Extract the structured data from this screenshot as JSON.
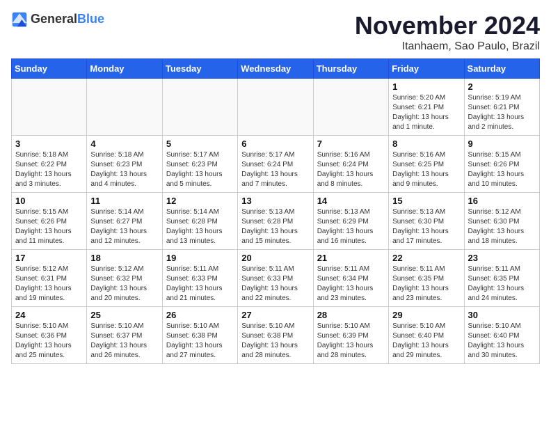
{
  "header": {
    "logo_general": "General",
    "logo_blue": "Blue",
    "month_title": "November 2024",
    "subtitle": "Itanhaem, Sao Paulo, Brazil"
  },
  "weekdays": [
    "Sunday",
    "Monday",
    "Tuesday",
    "Wednesday",
    "Thursday",
    "Friday",
    "Saturday"
  ],
  "weeks": [
    [
      {
        "day": "",
        "info": ""
      },
      {
        "day": "",
        "info": ""
      },
      {
        "day": "",
        "info": ""
      },
      {
        "day": "",
        "info": ""
      },
      {
        "day": "",
        "info": ""
      },
      {
        "day": "1",
        "info": "Sunrise: 5:20 AM\nSunset: 6:21 PM\nDaylight: 13 hours and 1 minute."
      },
      {
        "day": "2",
        "info": "Sunrise: 5:19 AM\nSunset: 6:21 PM\nDaylight: 13 hours and 2 minutes."
      }
    ],
    [
      {
        "day": "3",
        "info": "Sunrise: 5:18 AM\nSunset: 6:22 PM\nDaylight: 13 hours and 3 minutes."
      },
      {
        "day": "4",
        "info": "Sunrise: 5:18 AM\nSunset: 6:23 PM\nDaylight: 13 hours and 4 minutes."
      },
      {
        "day": "5",
        "info": "Sunrise: 5:17 AM\nSunset: 6:23 PM\nDaylight: 13 hours and 5 minutes."
      },
      {
        "day": "6",
        "info": "Sunrise: 5:17 AM\nSunset: 6:24 PM\nDaylight: 13 hours and 7 minutes."
      },
      {
        "day": "7",
        "info": "Sunrise: 5:16 AM\nSunset: 6:24 PM\nDaylight: 13 hours and 8 minutes."
      },
      {
        "day": "8",
        "info": "Sunrise: 5:16 AM\nSunset: 6:25 PM\nDaylight: 13 hours and 9 minutes."
      },
      {
        "day": "9",
        "info": "Sunrise: 5:15 AM\nSunset: 6:26 PM\nDaylight: 13 hours and 10 minutes."
      }
    ],
    [
      {
        "day": "10",
        "info": "Sunrise: 5:15 AM\nSunset: 6:26 PM\nDaylight: 13 hours and 11 minutes."
      },
      {
        "day": "11",
        "info": "Sunrise: 5:14 AM\nSunset: 6:27 PM\nDaylight: 13 hours and 12 minutes."
      },
      {
        "day": "12",
        "info": "Sunrise: 5:14 AM\nSunset: 6:28 PM\nDaylight: 13 hours and 13 minutes."
      },
      {
        "day": "13",
        "info": "Sunrise: 5:13 AM\nSunset: 6:28 PM\nDaylight: 13 hours and 15 minutes."
      },
      {
        "day": "14",
        "info": "Sunrise: 5:13 AM\nSunset: 6:29 PM\nDaylight: 13 hours and 16 minutes."
      },
      {
        "day": "15",
        "info": "Sunrise: 5:13 AM\nSunset: 6:30 PM\nDaylight: 13 hours and 17 minutes."
      },
      {
        "day": "16",
        "info": "Sunrise: 5:12 AM\nSunset: 6:30 PM\nDaylight: 13 hours and 18 minutes."
      }
    ],
    [
      {
        "day": "17",
        "info": "Sunrise: 5:12 AM\nSunset: 6:31 PM\nDaylight: 13 hours and 19 minutes."
      },
      {
        "day": "18",
        "info": "Sunrise: 5:12 AM\nSunset: 6:32 PM\nDaylight: 13 hours and 20 minutes."
      },
      {
        "day": "19",
        "info": "Sunrise: 5:11 AM\nSunset: 6:33 PM\nDaylight: 13 hours and 21 minutes."
      },
      {
        "day": "20",
        "info": "Sunrise: 5:11 AM\nSunset: 6:33 PM\nDaylight: 13 hours and 22 minutes."
      },
      {
        "day": "21",
        "info": "Sunrise: 5:11 AM\nSunset: 6:34 PM\nDaylight: 13 hours and 23 minutes."
      },
      {
        "day": "22",
        "info": "Sunrise: 5:11 AM\nSunset: 6:35 PM\nDaylight: 13 hours and 23 minutes."
      },
      {
        "day": "23",
        "info": "Sunrise: 5:11 AM\nSunset: 6:35 PM\nDaylight: 13 hours and 24 minutes."
      }
    ],
    [
      {
        "day": "24",
        "info": "Sunrise: 5:10 AM\nSunset: 6:36 PM\nDaylight: 13 hours and 25 minutes."
      },
      {
        "day": "25",
        "info": "Sunrise: 5:10 AM\nSunset: 6:37 PM\nDaylight: 13 hours and 26 minutes."
      },
      {
        "day": "26",
        "info": "Sunrise: 5:10 AM\nSunset: 6:38 PM\nDaylight: 13 hours and 27 minutes."
      },
      {
        "day": "27",
        "info": "Sunrise: 5:10 AM\nSunset: 6:38 PM\nDaylight: 13 hours and 28 minutes."
      },
      {
        "day": "28",
        "info": "Sunrise: 5:10 AM\nSunset: 6:39 PM\nDaylight: 13 hours and 28 minutes."
      },
      {
        "day": "29",
        "info": "Sunrise: 5:10 AM\nSunset: 6:40 PM\nDaylight: 13 hours and 29 minutes."
      },
      {
        "day": "30",
        "info": "Sunrise: 5:10 AM\nSunset: 6:40 PM\nDaylight: 13 hours and 30 minutes."
      }
    ]
  ]
}
